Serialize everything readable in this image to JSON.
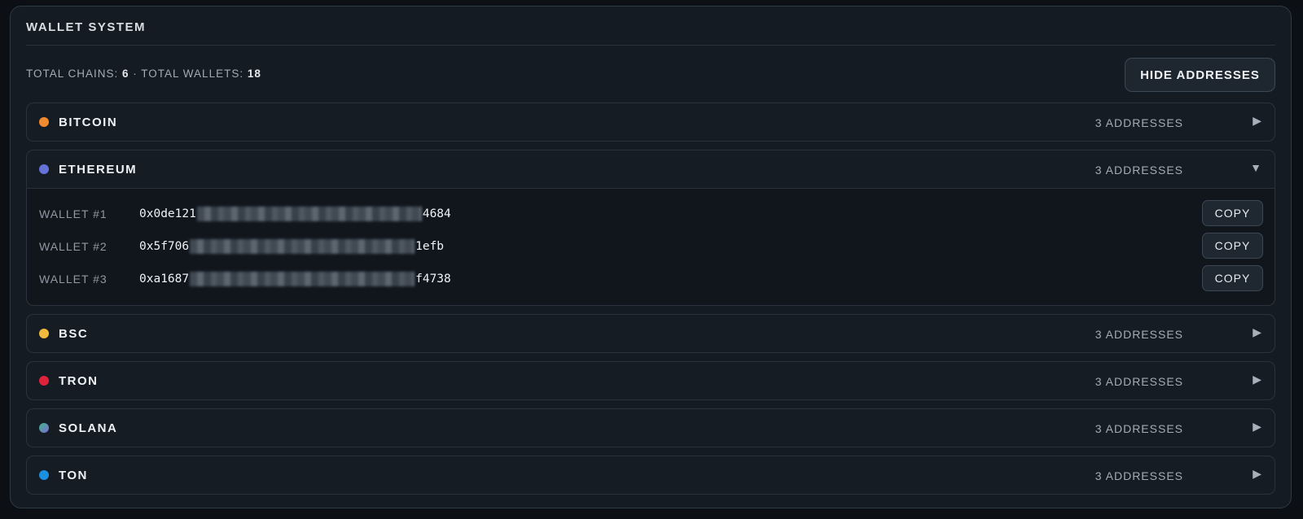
{
  "panel": {
    "title": "WALLET SYSTEM",
    "summary_prefix_chains": "TOTAL CHAINS: ",
    "total_chains": "6",
    "summary_sep": " · TOTAL WALLETS: ",
    "total_wallets": "18",
    "hide_button_label": "HIDE ADDRESSES"
  },
  "chains": [
    {
      "name": "BITCOIN",
      "count": "3 ADDRESSES",
      "arrow": "▶",
      "color": "#f08a2e"
    },
    {
      "name": "ETHEREUM",
      "count": "3 ADDRESSES",
      "arrow": "▼",
      "color": "#6572d6",
      "wallets": [
        {
          "label": "WALLET #1",
          "addr_start": "0x0de121",
          "addr_end": "4684",
          "copy": "COPY"
        },
        {
          "label": "WALLET #2",
          "addr_start": "0x5f706",
          "addr_end": "1efb",
          "copy": "COPY"
        },
        {
          "label": "WALLET #3",
          "addr_start": "0xa1687",
          "addr_end": "f4738",
          "copy": "COPY"
        }
      ]
    },
    {
      "name": "BSC",
      "count": "3 ADDRESSES",
      "arrow": "▶",
      "color": "#efb93b"
    },
    {
      "name": "TRON",
      "count": "3 ADDRESSES",
      "arrow": "▶",
      "color": "#e0223a"
    },
    {
      "name": "SOLANA",
      "count": "3 ADDRESSES",
      "arrow": "▶",
      "color": "#5a9fb0"
    },
    {
      "name": "TON",
      "count": "3 ADDRESSES",
      "arrow": "▶",
      "color": "#1d8fe0"
    }
  ]
}
